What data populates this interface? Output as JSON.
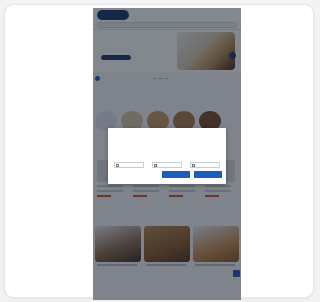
{
  "colors": {
    "brand_navy": "#1d3a6e",
    "accent_blue": "#1d5fbf",
    "price_orange": "#cf5a2c"
  },
  "header": {
    "logo_text": "",
    "nav": [
      "",
      "",
      "",
      ""
    ],
    "search_placeholder": ""
  },
  "hero": {
    "title": "",
    "subtitle": ""
  },
  "sections": {
    "categories_title": "",
    "ratgeber_title": "",
    "bottom_title": ""
  },
  "cookie_modal": {
    "title": "",
    "text": "",
    "options_label": "",
    "options": [
      {
        "label": ""
      },
      {
        "label": ""
      },
      {
        "label": ""
      }
    ],
    "link_label": "",
    "button_secondary": "",
    "button_primary": ""
  },
  "icons": [
    "logo-icon",
    "search-icon",
    "carousel-prev-icon",
    "next-arrow-icon"
  ]
}
